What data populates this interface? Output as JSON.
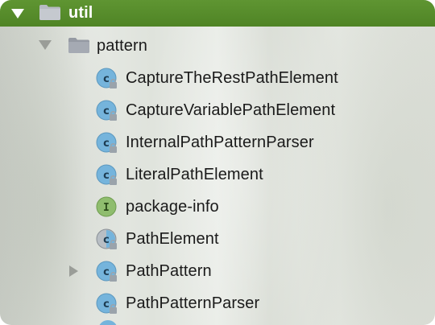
{
  "tree": {
    "root": {
      "label": "util",
      "expanded": true,
      "selected": true,
      "icon": "folder-icon"
    },
    "package": {
      "label": "pattern",
      "expanded": true,
      "icon": "folder-icon"
    },
    "items": [
      {
        "label": "CaptureTheRestPathElement",
        "icon": "class-icon",
        "kind": "class"
      },
      {
        "label": "CaptureVariablePathElement",
        "icon": "class-icon",
        "kind": "class"
      },
      {
        "label": "InternalPathPatternParser",
        "icon": "class-icon",
        "kind": "class"
      },
      {
        "label": "LiteralPathElement",
        "icon": "class-icon",
        "kind": "class"
      },
      {
        "label": "package-info",
        "icon": "interface-icon",
        "kind": "interface"
      },
      {
        "label": "PathElement",
        "icon": "abstract-class-icon",
        "kind": "abstract"
      },
      {
        "label": "PathPattern",
        "icon": "class-icon",
        "kind": "class",
        "collapsed": true
      },
      {
        "label": "PathPatternParser",
        "icon": "class-icon",
        "kind": "class"
      }
    ]
  },
  "colors": {
    "selection": "#55892a",
    "class_icon": "#6aaed6",
    "interface_icon": "#8ab869",
    "folder": "#a5aab3"
  }
}
